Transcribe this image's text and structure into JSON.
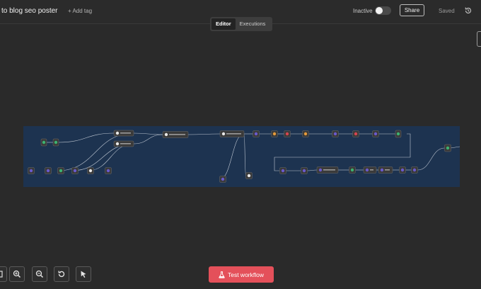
{
  "header": {
    "workflow_title": "to blog seo poster",
    "add_tag": "+ Add tag",
    "status_label": "Inactive",
    "share": "Share",
    "save_state": "Saved"
  },
  "tabs": [
    {
      "label": "Editor",
      "active": true
    },
    {
      "label": "Executions",
      "active": false
    }
  ],
  "canvas": {
    "sticky_note_color": "#1d3350",
    "node_color": "#3a3a3a",
    "connection_color": "#bfc7d2",
    "node_icon_colors": [
      "#6a5acd",
      "#d64550",
      "#3cb371",
      "#e8e8e8",
      "#e59a3b"
    ]
  },
  "controls": {
    "zoom_icons": [
      "fit-view-icon",
      "zoom-in-icon",
      "zoom-out-icon",
      "reset-zoom-icon",
      "pointer-icon"
    ],
    "test_workflow": "Test workflow"
  },
  "colors": {
    "accent": "#e4505a",
    "background": "#2a2a2a"
  }
}
